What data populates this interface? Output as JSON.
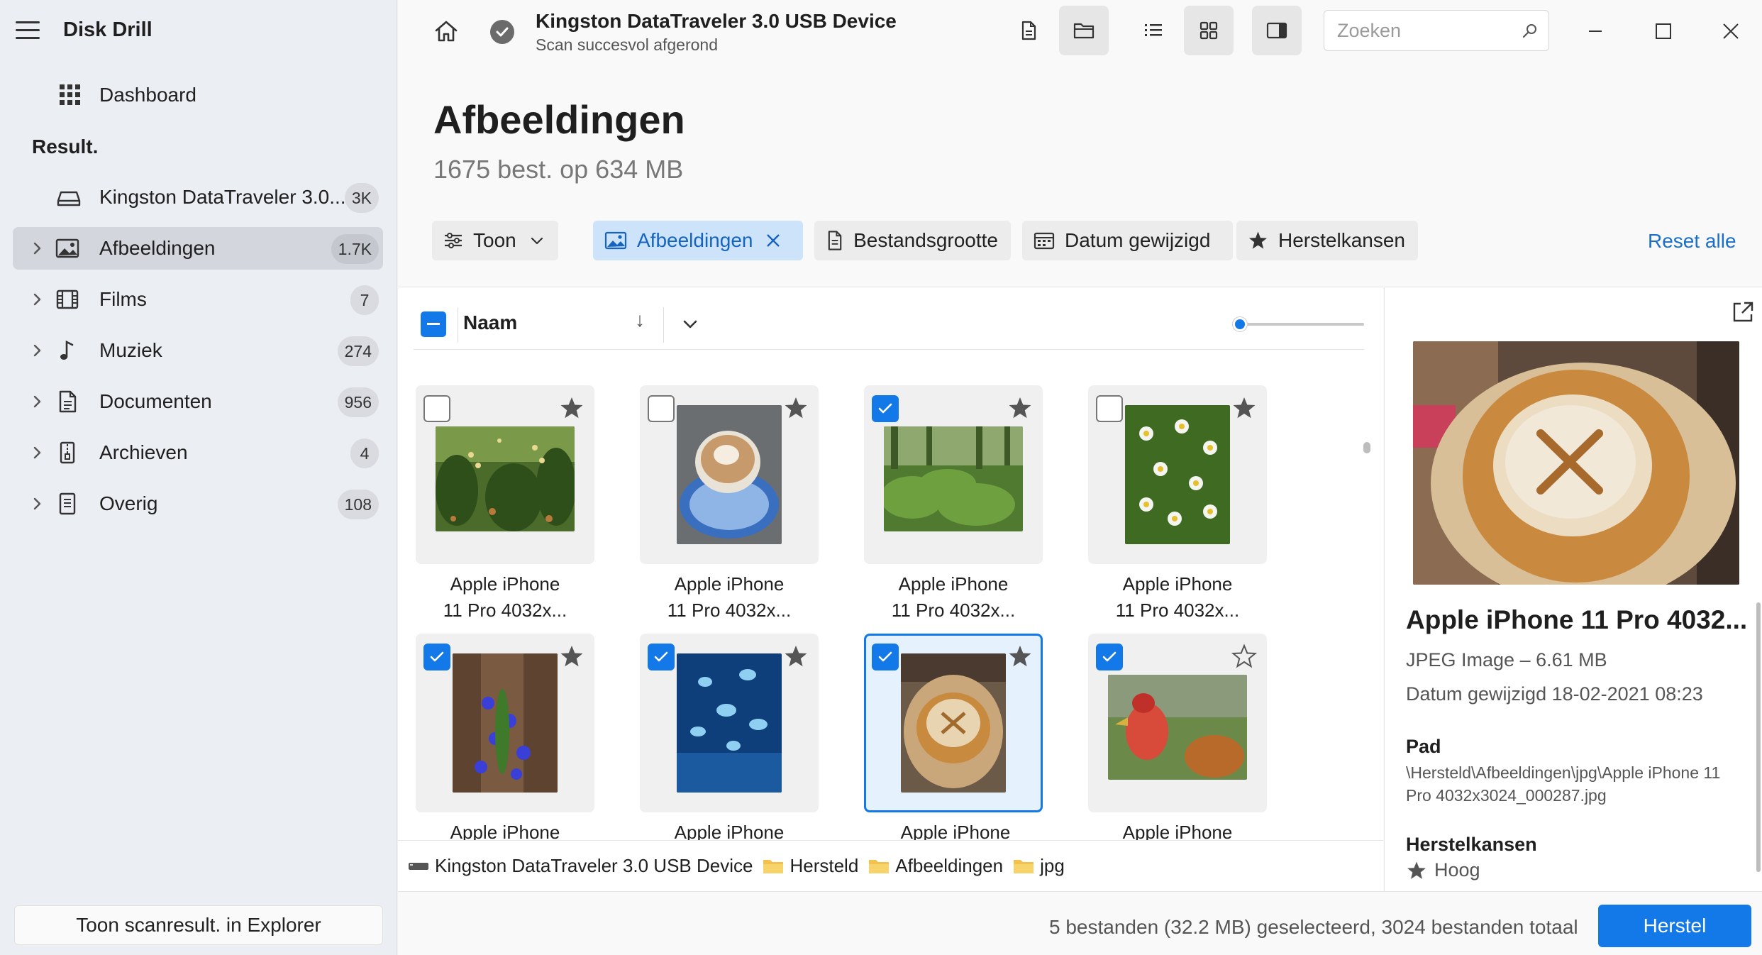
{
  "app": {
    "title": "Disk Drill"
  },
  "sidebar": {
    "dashboard_label": "Dashboard",
    "section_label": "Result.",
    "device": {
      "label": "Kingston DataTraveler 3.0...",
      "count": "3K"
    },
    "categories": [
      {
        "label": "Afbeeldingen",
        "count": "1.7K",
        "icon": "image-icon",
        "active": true
      },
      {
        "label": "Films",
        "count": "7",
        "icon": "film-icon"
      },
      {
        "label": "Muziek",
        "count": "274",
        "icon": "music-icon"
      },
      {
        "label": "Documenten",
        "count": "956",
        "icon": "document-icon"
      },
      {
        "label": "Archieven",
        "count": "4",
        "icon": "archive-icon"
      },
      {
        "label": "Overig",
        "count": "108",
        "icon": "other-file-icon"
      }
    ],
    "explorer_button": "Toon scanresult. in Explorer"
  },
  "header": {
    "device_title": "Kingston DataTraveler 3.0 USB Device",
    "device_status": "Scan succesvol afgerond",
    "search_placeholder": "Zoeken"
  },
  "page": {
    "title": "Afbeeldingen",
    "subtitle": "1675 best. op 634 MB"
  },
  "filters": {
    "show_label": "Toon",
    "active_filter": "Afbeeldingen",
    "size_label": "Bestandsgrootte",
    "date_label": "Datum gewijzigd",
    "chances_label": "Herstelkansen",
    "reset_label": "Reset alle"
  },
  "sort": {
    "column": "Naam",
    "arrow": "↓"
  },
  "thumb_size_slider": {
    "value": 0
  },
  "files": [
    {
      "line1": "Apple iPhone",
      "line2": "11 Pro 4032x...",
      "checked": false,
      "selected": false,
      "star": "filled"
    },
    {
      "line1": "Apple iPhone",
      "line2": "11 Pro 4032x...",
      "checked": false,
      "selected": false,
      "star": "filled"
    },
    {
      "line1": "Apple iPhone",
      "line2": "11 Pro 4032x...",
      "checked": true,
      "selected": false,
      "star": "filled"
    },
    {
      "line1": "Apple iPhone",
      "line2": "11 Pro 4032x...",
      "checked": false,
      "selected": false,
      "star": "filled"
    },
    {
      "line1": "Apple iPhone",
      "line2": "",
      "checked": true,
      "selected": false,
      "star": "filled"
    },
    {
      "line1": "Apple iPhone",
      "line2": "",
      "checked": true,
      "selected": false,
      "star": "filled"
    },
    {
      "line1": "Apple iPhone",
      "line2": "",
      "checked": true,
      "selected": true,
      "star": "filled"
    },
    {
      "line1": "Apple iPhone",
      "line2": "",
      "checked": true,
      "selected": false,
      "star": "outline"
    }
  ],
  "breadcrumb": [
    {
      "label": "Kingston DataTraveler 3.0 USB Device",
      "icon": "drive-icon"
    },
    {
      "label": "Hersteld",
      "icon": "folder-icon"
    },
    {
      "label": "Afbeeldingen",
      "icon": "folder-icon"
    },
    {
      "label": "jpg",
      "icon": "folder-icon"
    }
  ],
  "preview": {
    "title": "Apple iPhone 11 Pro 4032...",
    "type_size": "JPEG Image – 6.61 MB",
    "date": "Datum gewijzigd 18-02-2021 08:23",
    "path_heading": "Pad",
    "path": "\\Hersteld\\Afbeeldingen\\jpg\\Apple iPhone 11 Pro 4032x3024_000287.jpg",
    "chances_heading": "Herstelkansen",
    "chances_value": "Hoog"
  },
  "status": {
    "summary": "5 bestanden (32.2 MB) geselecteerd, 3024 bestanden totaal",
    "recover_button": "Herstel"
  },
  "colors": {
    "accent": "#1479e8",
    "active_chip_bg": "#cde3fa",
    "active_chip_text": "#1565c0"
  }
}
